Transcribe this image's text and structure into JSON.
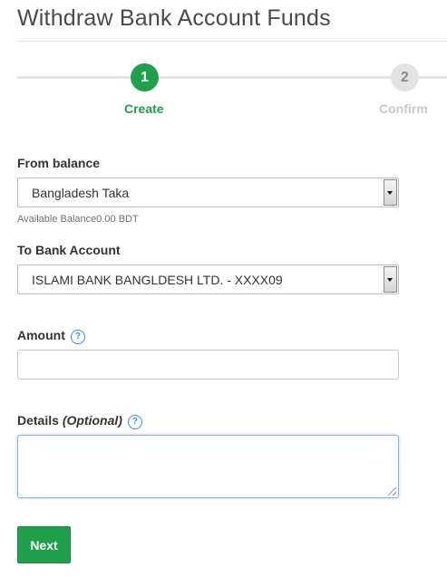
{
  "page": {
    "title": "Withdraw Bank Account Funds"
  },
  "stepper": {
    "steps": [
      {
        "number": "1",
        "label": "Create",
        "state": "active"
      },
      {
        "number": "2",
        "label": "Confirm",
        "state": "inactive"
      }
    ]
  },
  "form": {
    "from_balance": {
      "label": "From balance",
      "selected": "Bangladesh Taka",
      "hint": "Available Balance0.00 BDT"
    },
    "to_bank_account": {
      "label": "To Bank Account",
      "selected": "ISLAMI BANK BANGLDESH LTD. - XXXX09"
    },
    "amount": {
      "label": "Amount",
      "help": "?",
      "value": ""
    },
    "details": {
      "label": "Details",
      "optional_label": "(Optional)",
      "help": "?",
      "value": ""
    },
    "next_label": "Next"
  },
  "colors": {
    "accent": "#1fa04a",
    "inactive_step": "#e3e3e3",
    "help_icon": "#3b8fd6"
  }
}
